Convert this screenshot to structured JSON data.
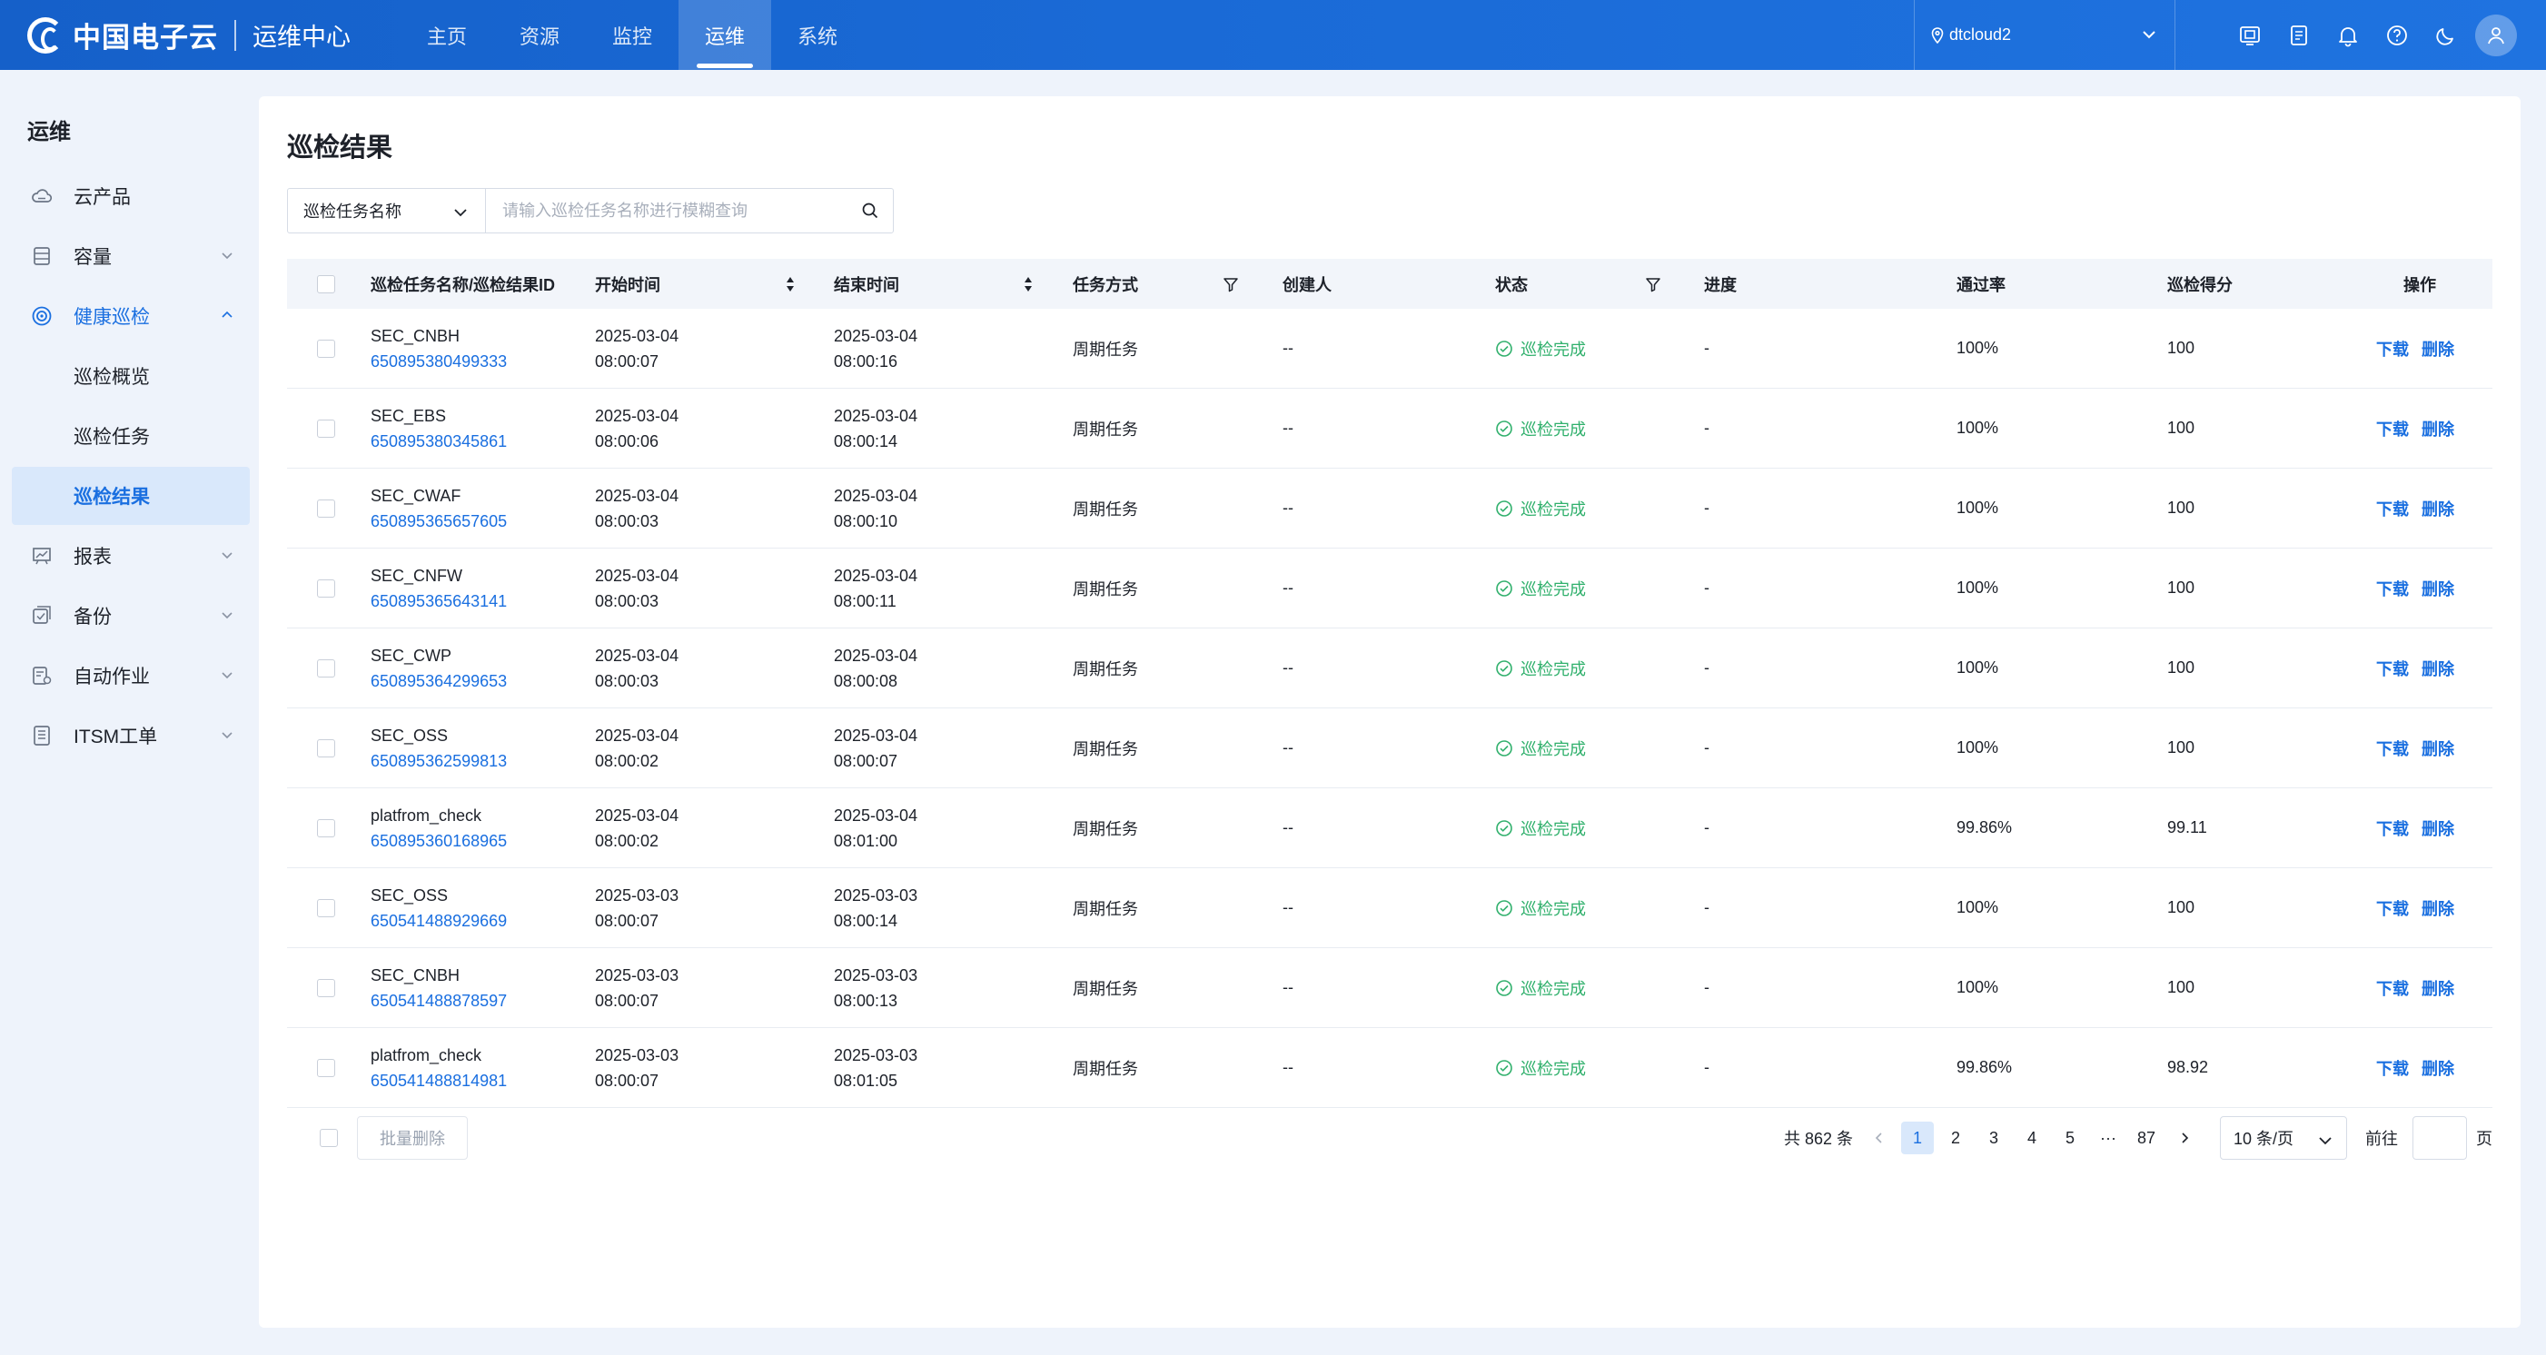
{
  "brand": {
    "name": "中国电子云",
    "sub": "运维中心"
  },
  "nav": [
    {
      "label": "主页",
      "name": "nav-home",
      "active": false
    },
    {
      "label": "资源",
      "name": "nav-resources",
      "active": false
    },
    {
      "label": "监控",
      "name": "nav-monitor",
      "active": false
    },
    {
      "label": "运维",
      "name": "nav-ops",
      "active": true
    },
    {
      "label": "系统",
      "name": "nav-system",
      "active": false
    }
  ],
  "region": {
    "label": "dtcloud2"
  },
  "topIcons": [
    "screen-icon",
    "document-icon",
    "bell-icon",
    "help-icon",
    "moon-icon"
  ],
  "sidebar": {
    "title": "运维",
    "items": [
      {
        "label": "云产品",
        "icon": "cloud-icon",
        "expandable": false
      },
      {
        "label": "容量",
        "icon": "database-icon",
        "expandable": true
      },
      {
        "label": "健康巡检",
        "icon": "target-icon",
        "expandable": true,
        "open": true,
        "children": [
          {
            "label": "巡检概览",
            "active": false
          },
          {
            "label": "巡检任务",
            "active": false
          },
          {
            "label": "巡检结果",
            "active": true
          }
        ]
      },
      {
        "label": "报表",
        "icon": "report-icon",
        "expandable": true
      },
      {
        "label": "备份",
        "icon": "backup-icon",
        "expandable": true
      },
      {
        "label": "自动作业",
        "icon": "automation-icon",
        "expandable": true
      },
      {
        "label": "ITSM工单",
        "icon": "ticket-icon",
        "expandable": true
      }
    ]
  },
  "page": {
    "title": "巡检结果"
  },
  "search": {
    "field": "巡检任务名称",
    "placeholder": "请输入巡检任务名称进行模糊查询"
  },
  "table": {
    "columns": {
      "name": "巡检任务名称/巡检结果ID",
      "start": "开始时间",
      "end": "结束时间",
      "mode": "任务方式",
      "creator": "创建人",
      "status": "状态",
      "progress": "进度",
      "pass": "通过率",
      "score": "巡检得分",
      "ops": "操作"
    },
    "rows": [
      {
        "name": "SEC_CNBH",
        "id": "650895380499333",
        "startDate": "2025-03-04",
        "startTime": "08:00:07",
        "endDate": "2025-03-04",
        "endTime": "08:00:16",
        "mode": "周期任务",
        "creator": "--",
        "status": "巡检完成",
        "progress": "-",
        "pass": "100%",
        "score": "100"
      },
      {
        "name": "SEC_EBS",
        "id": "650895380345861",
        "startDate": "2025-03-04",
        "startTime": "08:00:06",
        "endDate": "2025-03-04",
        "endTime": "08:00:14",
        "mode": "周期任务",
        "creator": "--",
        "status": "巡检完成",
        "progress": "-",
        "pass": "100%",
        "score": "100"
      },
      {
        "name": "SEC_CWAF",
        "id": "650895365657605",
        "startDate": "2025-03-04",
        "startTime": "08:00:03",
        "endDate": "2025-03-04",
        "endTime": "08:00:10",
        "mode": "周期任务",
        "creator": "--",
        "status": "巡检完成",
        "progress": "-",
        "pass": "100%",
        "score": "100"
      },
      {
        "name": "SEC_CNFW",
        "id": "650895365643141",
        "startDate": "2025-03-04",
        "startTime": "08:00:03",
        "endDate": "2025-03-04",
        "endTime": "08:00:11",
        "mode": "周期任务",
        "creator": "--",
        "status": "巡检完成",
        "progress": "-",
        "pass": "100%",
        "score": "100"
      },
      {
        "name": "SEC_CWP",
        "id": "650895364299653",
        "startDate": "2025-03-04",
        "startTime": "08:00:03",
        "endDate": "2025-03-04",
        "endTime": "08:00:08",
        "mode": "周期任务",
        "creator": "--",
        "status": "巡检完成",
        "progress": "-",
        "pass": "100%",
        "score": "100"
      },
      {
        "name": "SEC_OSS",
        "id": "650895362599813",
        "startDate": "2025-03-04",
        "startTime": "08:00:02",
        "endDate": "2025-03-04",
        "endTime": "08:00:07",
        "mode": "周期任务",
        "creator": "--",
        "status": "巡检完成",
        "progress": "-",
        "pass": "100%",
        "score": "100"
      },
      {
        "name": "platfrom_check",
        "id": "650895360168965",
        "startDate": "2025-03-04",
        "startTime": "08:00:02",
        "endDate": "2025-03-04",
        "endTime": "08:01:00",
        "mode": "周期任务",
        "creator": "--",
        "status": "巡检完成",
        "progress": "-",
        "pass": "99.86%",
        "score": "99.11"
      },
      {
        "name": "SEC_OSS",
        "id": "650541488929669",
        "startDate": "2025-03-03",
        "startTime": "08:00:07",
        "endDate": "2025-03-03",
        "endTime": "08:00:14",
        "mode": "周期任务",
        "creator": "--",
        "status": "巡检完成",
        "progress": "-",
        "pass": "100%",
        "score": "100"
      },
      {
        "name": "SEC_CNBH",
        "id": "650541488878597",
        "startDate": "2025-03-03",
        "startTime": "08:00:07",
        "endDate": "2025-03-03",
        "endTime": "08:00:13",
        "mode": "周期任务",
        "creator": "--",
        "status": "巡检完成",
        "progress": "-",
        "pass": "100%",
        "score": "100"
      },
      {
        "name": "platfrom_check",
        "id": "650541488814981",
        "startDate": "2025-03-03",
        "startTime": "08:00:07",
        "endDate": "2025-03-03",
        "endTime": "08:01:05",
        "mode": "周期任务",
        "creator": "--",
        "status": "巡检完成",
        "progress": "-",
        "pass": "99.86%",
        "score": "98.92"
      }
    ],
    "actions": {
      "download": "下载",
      "delete": "删除"
    }
  },
  "footer": {
    "batchDelete": "批量删除",
    "total": "共 862 条",
    "pages": [
      "1",
      "2",
      "3",
      "4",
      "5",
      "···",
      "87"
    ],
    "currentPage": "1",
    "pageSize": "10 条/页",
    "goto": "前往",
    "pageUnit": "页"
  },
  "colors": {
    "primary": "#1a6fe0",
    "success": "#30b06c",
    "topbar": "#1a6ad6"
  }
}
